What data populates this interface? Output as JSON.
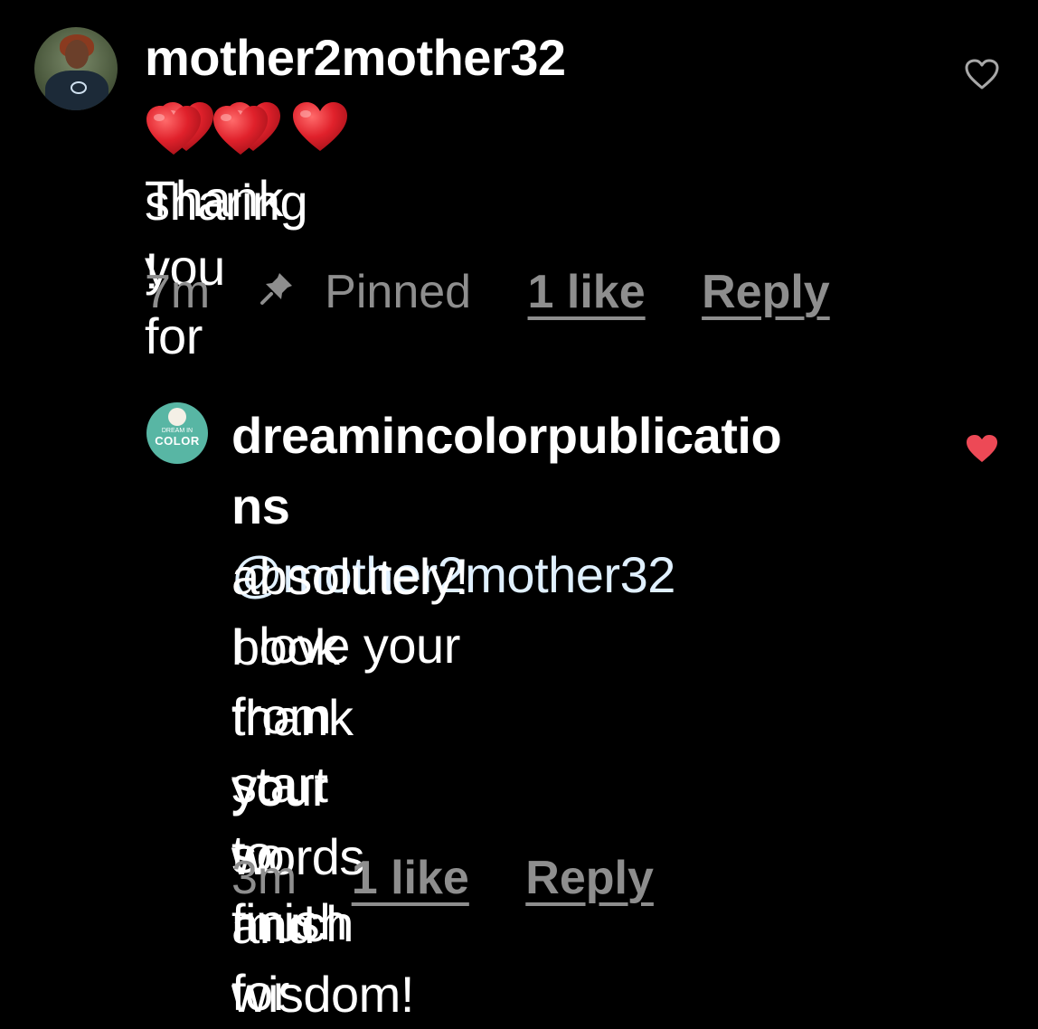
{
  "comments": [
    {
      "username": "mother2mother32",
      "line_1_text": "Thank you for",
      "line_2_text": "sharing !",
      "emoji": "red-heart",
      "emoji_count": 5,
      "time": "7m",
      "pinned_label": "Pinned",
      "likes": "1 like",
      "reply": "Reply",
      "liked": false
    },
    {
      "username_part_1": "dreamincolorpublicatio",
      "username_part_2": "ns",
      "mention": "@mother2mother32",
      "body_lines": [
        "absolutely! I love your",
        "book from start to finish",
        "thank you so much for",
        "your words and wisdom!"
      ],
      "avatar_text_small": "DREAM IN",
      "avatar_text_big": "COLOR",
      "time": "3m",
      "likes": "1 like",
      "reply": "Reply",
      "liked": true
    }
  ],
  "colors": {
    "background": "#000000",
    "text": "#ffffff",
    "meta": "#8e8e8e",
    "heart": "#ed4956",
    "emoji_heart": "#e0212b"
  },
  "icons": {
    "pin": "pin-icon",
    "like_outline": "heart-outline-icon",
    "like_filled": "heart-filled-icon"
  }
}
